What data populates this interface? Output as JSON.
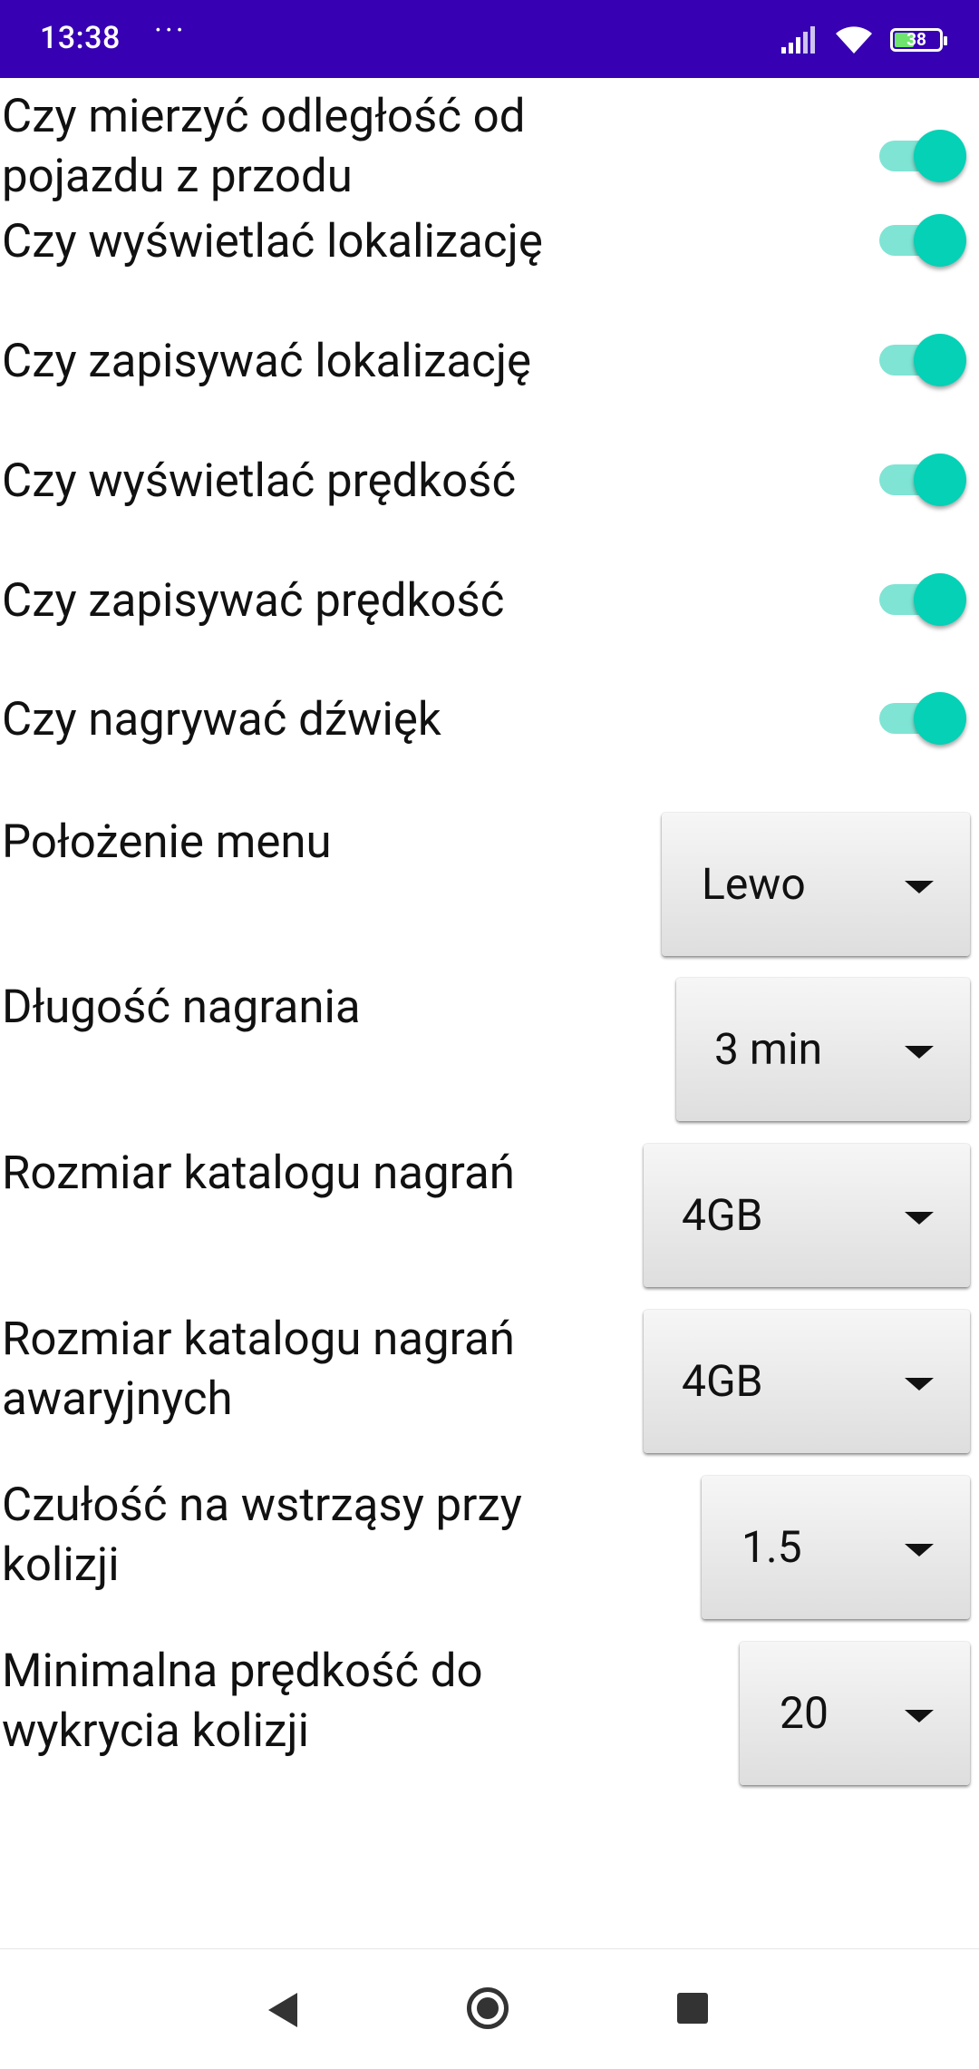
{
  "status_bar": {
    "time": "13:38",
    "more": "···",
    "battery_level": "38",
    "background": "#3700b3"
  },
  "settings": {
    "toggles": [
      {
        "label": "Czy mierzyć odległość od pojazdu z przodu",
        "checked": true
      },
      {
        "label": "Czy wyświetlać lokalizację",
        "checked": true
      },
      {
        "label": "Czy zapisywać lokalizację",
        "checked": true
      },
      {
        "label": "Czy wyświetlać prędkość",
        "checked": true
      },
      {
        "label": "Czy zapisywać prędkość",
        "checked": true
      },
      {
        "label": "Czy nagrywać dźwięk",
        "checked": true
      }
    ],
    "spinners": [
      {
        "label": "Położenie menu",
        "value": "Lewo"
      },
      {
        "label": "Długość nagrania",
        "value": "3 min"
      },
      {
        "label": "Rozmiar katalogu nagrań",
        "value": "4GB"
      },
      {
        "label": "Rozmiar katalogu nagrań awaryjnych",
        "value": "4GB"
      },
      {
        "label": "Czułość na wstrząsy przy kolizji",
        "value": "1.5"
      },
      {
        "label": "Minimalna prędkość do wykrycia kolizji",
        "value": "20"
      }
    ],
    "accent_color": "#04d1b6"
  },
  "nav_bar": {
    "back_icon": "triangle-back",
    "home_icon": "circle-home",
    "recents_icon": "square-recents"
  }
}
